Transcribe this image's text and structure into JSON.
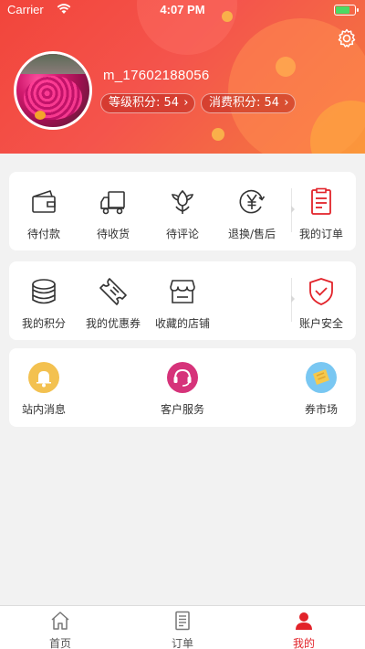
{
  "status_bar": {
    "carrier": "Carrier",
    "time": "4:07 PM"
  },
  "profile": {
    "username": "m_17602188056",
    "level_points": {
      "label": "等级积分:",
      "value": "54"
    },
    "spend_points": {
      "label": "消费积分:",
      "value": "54"
    }
  },
  "orders": {
    "items": [
      {
        "label": "待付款",
        "icon": "wallet-icon"
      },
      {
        "label": "待收货",
        "icon": "truck-icon"
      },
      {
        "label": "待评论",
        "icon": "flower-icon"
      },
      {
        "label": "退换/售后",
        "icon": "yen-refund-icon"
      }
    ],
    "my_orders": {
      "label": "我的订单",
      "icon": "order-list-icon"
    }
  },
  "assets": {
    "items": [
      {
        "label": "我的积分",
        "icon": "coins-icon"
      },
      {
        "label": "我的优惠券",
        "icon": "coupon-icon"
      },
      {
        "label": "收藏的店铺",
        "icon": "store-icon"
      }
    ],
    "account_security": {
      "label": "账户安全",
      "icon": "shield-check-icon"
    }
  },
  "services": {
    "items": [
      {
        "label": "站内消息",
        "icon": "bell-icon",
        "color": "#f3c150"
      },
      {
        "label": "客户服务",
        "icon": "headset-icon",
        "color": "#d6337a"
      },
      {
        "label": "券市场",
        "icon": "ticket-icon",
        "color": "#79c7f2"
      }
    ]
  },
  "tabbar": {
    "tabs": [
      {
        "label": "首页",
        "icon": "home-icon",
        "active": false
      },
      {
        "label": "订单",
        "icon": "document-icon",
        "active": false
      },
      {
        "label": "我的",
        "icon": "person-icon",
        "active": true
      }
    ],
    "active_color": "#e2232a"
  }
}
